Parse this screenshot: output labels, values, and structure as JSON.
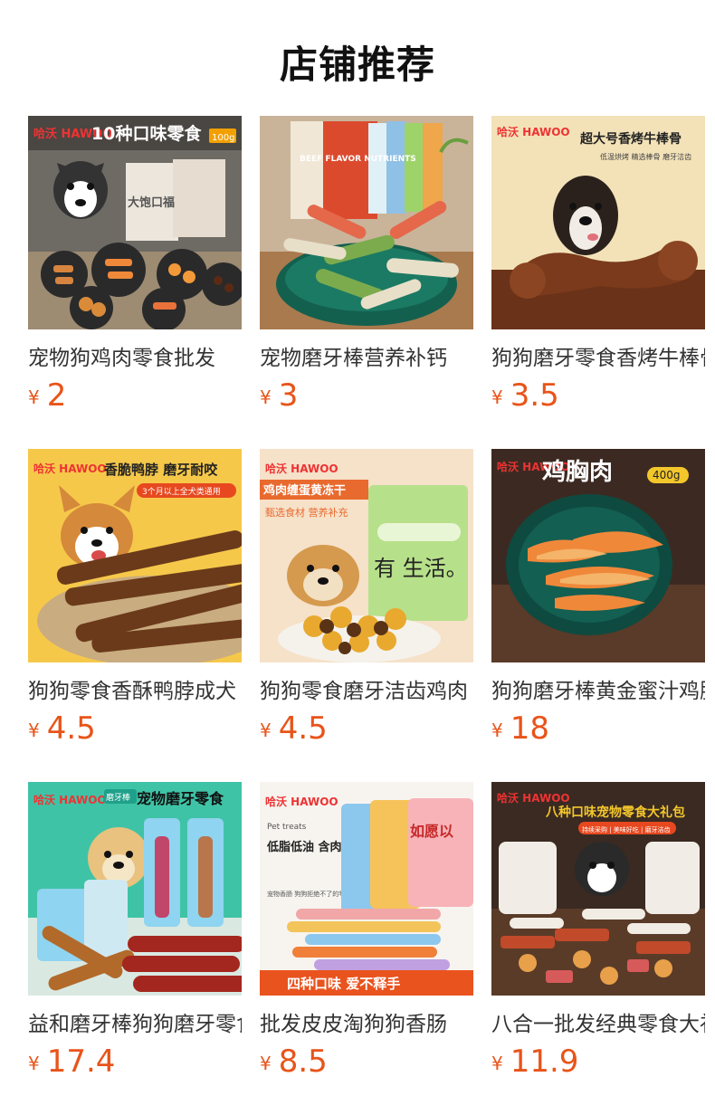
{
  "page_title": "店铺推荐",
  "currency": "¥",
  "colors": {
    "price": "#e8541a",
    "title": "#111111"
  },
  "products": [
    {
      "name": "宠物狗鸡肉零食批发",
      "price": "2",
      "image": {
        "icon": "dog-treats-variety-pack",
        "banner": "10种口味零食",
        "brand": "哈沃 HAWOO",
        "tag": "100g",
        "pkg": "大饱口福"
      }
    },
    {
      "name": "宠物磨牙棒营养补钙",
      "price": "3",
      "image": {
        "icon": "dental-chew-sticks",
        "pkg": "BEEF FLAVOR NUTRIENTS"
      }
    },
    {
      "name": "狗狗磨牙零食香烤牛棒骨",
      "price": "3.5",
      "image": {
        "icon": "roasted-beef-bone",
        "banner": "超大号香烤牛棒骨",
        "sub": "低温烘烤 精选棒骨 磨牙洁齿",
        "brand": "哈沃 HAWOO"
      }
    },
    {
      "name": "狗狗零食香酥鸭脖成犬",
      "price": "4.5",
      "image": {
        "icon": "crispy-duck-neck",
        "banner": "香脆鸭脖 磨牙耐咬",
        "sub": "3个月以上全犬类通用",
        "brand": "哈沃 HAWOO"
      }
    },
    {
      "name": "狗狗零食磨牙洁齿鸡肉",
      "price": "4.5",
      "image": {
        "icon": "chicken-egg-yolk-freeze-dried",
        "banner": "鸡肉缠蛋黄冻干",
        "sub": "甄选食材 营养补充",
        "brand": "哈沃 HAWOO",
        "pkg": "有 生活。"
      }
    },
    {
      "name": "狗狗磨牙棒黄金蜜汁鸡胸肉",
      "price": "18",
      "image": {
        "icon": "chicken-breast-jerky",
        "banner": "鸡胸肉",
        "brand": "哈沃 HAWOO",
        "tag": "400g"
      }
    },
    {
      "name": "益和磨牙棒狗狗磨牙零食",
      "price": "17.4",
      "image": {
        "icon": "dental-stick-rolls",
        "banner": "宠物磨牙零食",
        "brand": "哈沃 HAWOO",
        "sub": "磨牙棒"
      }
    },
    {
      "name": "批发皮皮淘狗狗香肠",
      "price": "8.5",
      "image": {
        "icon": "pet-sausages",
        "banner": "低脂低油 含肉量高",
        "sub": "宠物香肠 狗狗拒绝不了的零食",
        "brand": "哈沃 HAWOO",
        "tag": "Pet treats",
        "footer": "四种口味 爱不释手",
        "pkg": "如愿以"
      }
    },
    {
      "name": "八合一批发经典零食大礼包",
      "price": "11.9",
      "image": {
        "icon": "eight-flavor-gift-pack",
        "banner": "八种口味宠物零食大礼包",
        "sub": "持续采购 | 美味好吃 | 磨牙洁齿",
        "brand": "哈沃 HAWOO"
      }
    }
  ]
}
